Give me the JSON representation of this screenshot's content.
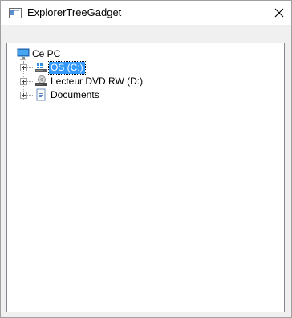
{
  "window": {
    "title": "ExplorerTreeGadget",
    "close_glyph": "✕"
  },
  "tree": {
    "root": {
      "label": "Ce PC",
      "icon": "computer-icon"
    },
    "items": [
      {
        "label": "OS (C:)",
        "icon": "drive-os-icon",
        "selected": true
      },
      {
        "label": "Lecteur DVD RW (D:)",
        "icon": "dvd-drive-icon",
        "selected": false
      },
      {
        "label": "Documents",
        "icon": "documents-icon",
        "selected": false
      }
    ]
  },
  "colors": {
    "selection": "#3399ff",
    "panel_border": "#828790"
  }
}
